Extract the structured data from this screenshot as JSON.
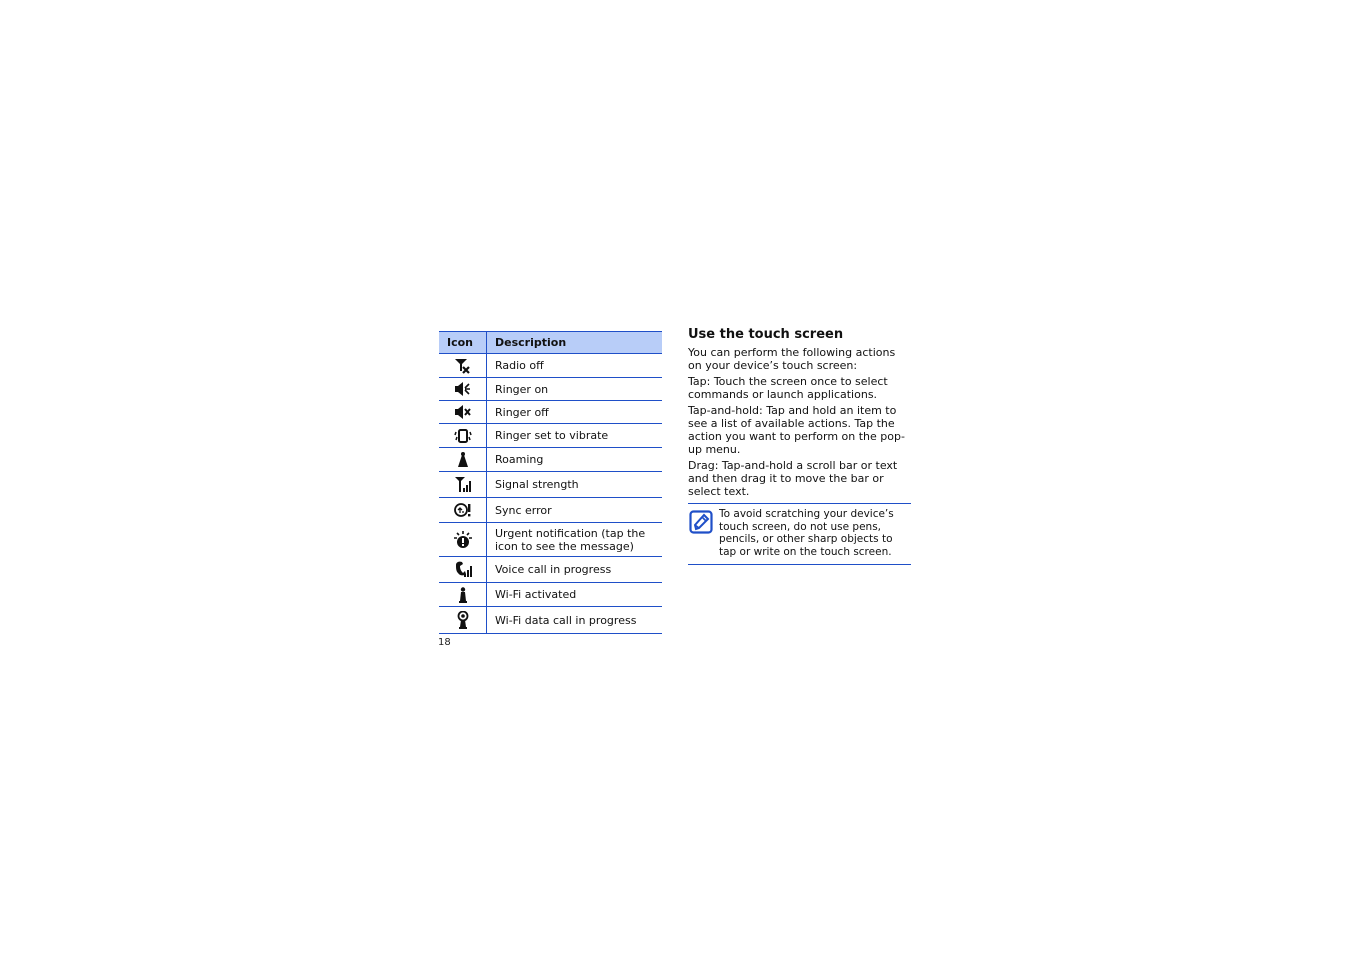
{
  "table": {
    "headers": {
      "icon": "Icon",
      "description": "Description"
    },
    "rows": [
      {
        "icon": "radio-off-icon",
        "description": "Radio off"
      },
      {
        "icon": "ringer-on-icon",
        "description": "Ringer on"
      },
      {
        "icon": "ringer-off-icon",
        "description": "Ringer off"
      },
      {
        "icon": "vibrate-icon",
        "description": "Ringer set to vibrate"
      },
      {
        "icon": "roaming-icon",
        "description": "Roaming"
      },
      {
        "icon": "signal-strength-icon",
        "description": "Signal strength"
      },
      {
        "icon": "sync-error-icon",
        "description": "Sync error"
      },
      {
        "icon": "urgent-notification-icon",
        "description": "Urgent notification (tap the icon to see the message)"
      },
      {
        "icon": "voice-call-icon",
        "description": "Voice call in progress"
      },
      {
        "icon": "wifi-activated-icon",
        "description": "Wi-Fi activated"
      },
      {
        "icon": "wifi-data-call-icon",
        "description": "Wi-Fi data call in progress"
      }
    ]
  },
  "page_number": "18",
  "section": {
    "title": "Use the touch screen",
    "intro": "You can perform the following actions on your device’s touch screen:",
    "paragraphs": [
      "Tap: Touch the screen once to select commands or launch applications.",
      "Tap-and-hold: Tap and hold an item to see a list of available actions. Tap the action you want to perform on the pop-up menu.",
      "Drag: Tap-and-hold a scroll bar or text and then drag it to move the bar or select text."
    ],
    "note": {
      "icon": "note-pencil-icon",
      "text": "To avoid scratching your device’s touch screen, do not use pens, pencils, or other sharp objects to tap or write on the touch screen."
    }
  },
  "colors": {
    "rule_blue": "#1f4fc8",
    "header_fill": "#b8cdf8"
  }
}
